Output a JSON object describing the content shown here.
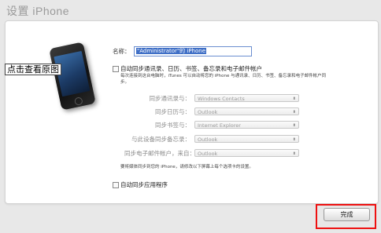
{
  "page": {
    "title": "设置 iPhone",
    "view_original": "点击查看原图"
  },
  "device_name": {
    "label": "名称：",
    "value": "\"Administrator\"的 iPhone"
  },
  "auto_sync_contacts": {
    "label": "自动同步通讯录、日历、书签、备忘录和电子邮件帐户",
    "description": "每次连接到这台电脑时，iTunes 可以自动将您的 iPhone 与通讯录、日历、书签、备忘录和电子邮件帐户同步。"
  },
  "sync_rows": [
    {
      "label": "同步通讯录与：",
      "value": "Windows Contacts"
    },
    {
      "label": "同步日历与：",
      "value": "Outlook"
    },
    {
      "label": "同步书签与：",
      "value": "Internet Explorer"
    },
    {
      "label": "与此设备同步备忘录：",
      "value": "Outlook"
    },
    {
      "label": "同步电子邮件帐户，来自：",
      "value": "Outlook"
    }
  ],
  "note": "要将媒体同步到您的 iPhone，请修改以下屏幕上每个选项卡的设置。",
  "auto_sync_apps": {
    "label": "自动同步应用程序"
  },
  "done_button": "完成",
  "colors": {
    "highlight": "#ee1111",
    "selection": "#3f6fc6",
    "background": "#e8e8e8"
  },
  "icons": {
    "select_arrow": "select-arrow-icon",
    "device": "iphone-icon"
  }
}
